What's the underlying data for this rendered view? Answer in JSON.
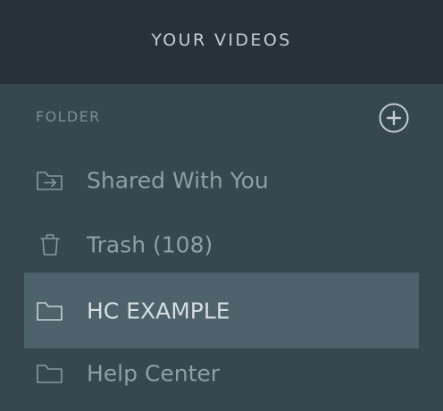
{
  "header": {
    "title": "YOUR VIDEOS"
  },
  "folder_section": {
    "label": "FOLDER",
    "add_icon": "plus-circle-icon"
  },
  "items": [
    {
      "label": "Shared With You",
      "icon": "shared-folder-icon",
      "selected": false
    },
    {
      "label": "Trash (108)",
      "icon": "trash-icon",
      "selected": false
    },
    {
      "label": "HC EXAMPLE",
      "icon": "folder-icon",
      "selected": true
    },
    {
      "label": "Help Center",
      "icon": "folder-icon",
      "selected": false
    }
  ],
  "colors": {
    "header_bg": "#263238",
    "panel_bg": "#37474f",
    "selected_bg": "#4e626c",
    "text_muted": "#909ea5",
    "text_selected": "#d6dde0"
  }
}
